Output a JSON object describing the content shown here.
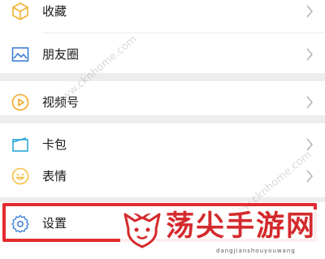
{
  "menu": {
    "items": [
      {
        "label": "收藏",
        "icon": "favorites-cube-icon"
      },
      {
        "label": "朋友圈",
        "icon": "moments-picture-icon"
      },
      {
        "label": "视频号",
        "icon": "channels-play-icon"
      },
      {
        "label": "卡包",
        "icon": "card-wallet-icon"
      },
      {
        "label": "表情",
        "icon": "sticker-smiley-icon"
      },
      {
        "label": "设置",
        "icon": "settings-gear-icon"
      }
    ]
  },
  "overlay": {
    "brand_name": "荡尖手游网",
    "brand_url": "dangjianshouyouwang",
    "watermark_text": "www.cknhome.com",
    "highlight_color": "#e32b2f"
  },
  "colors": {
    "favorites_icon": "#f2b233",
    "moments_icon": "#3f7fd6",
    "channels_icon": "#f5a623",
    "card_icon": "#2aa8d8",
    "sticker_icon": "#f5c242",
    "settings_icon": "#3f7fd6",
    "brand_red": "#d42a2d"
  }
}
